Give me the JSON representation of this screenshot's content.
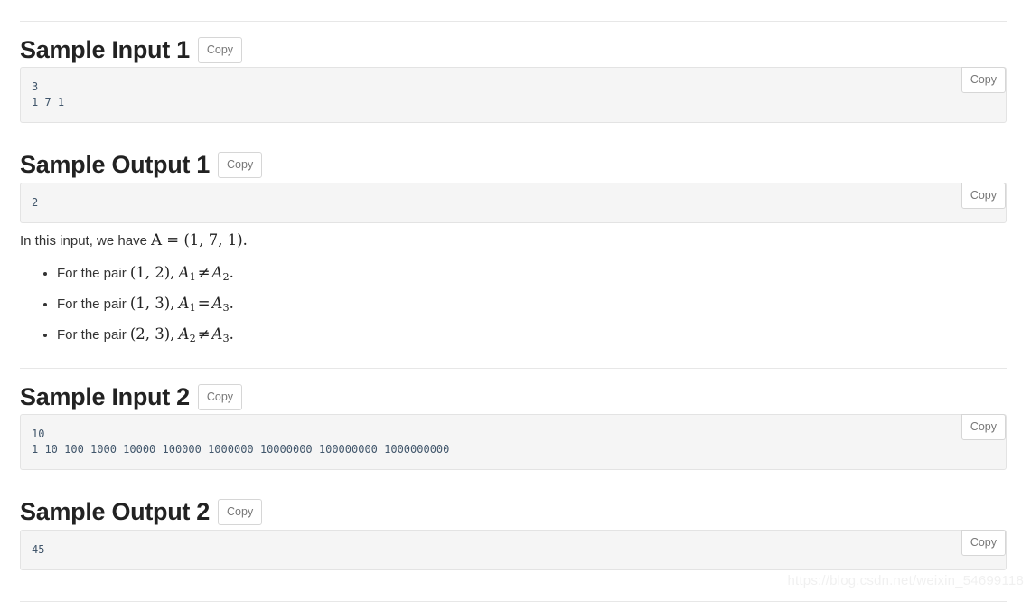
{
  "copy_label": "Copy",
  "sections": [
    {
      "id": "sample-input-1",
      "title": "Sample Input 1",
      "code": "3\n1 7 1"
    },
    {
      "id": "sample-output-1",
      "title": "Sample Output 1",
      "code": "2"
    },
    {
      "id": "sample-input-2",
      "title": "Sample Input 2",
      "code": "10\n1 10 100 1000 10000 100000 1000000 10000000 100000000 1000000000"
    },
    {
      "id": "sample-output-2",
      "title": "Sample Output 2",
      "code": "45"
    }
  ],
  "explanation": {
    "intro_prefix": "In this input, we have ",
    "intro_math": "A = (1, 7, 1).",
    "bullets": [
      {
        "text": "For the pair ",
        "pair": "(1, 2),",
        "relation_left": "A",
        "relation_left_sub": "1",
        "operator": "≠",
        "relation_right": "A",
        "relation_right_sub": "2",
        "suffix": "."
      },
      {
        "text": "For the pair ",
        "pair": "(1, 3),",
        "relation_left": "A",
        "relation_left_sub": "1",
        "operator": "=",
        "relation_right": "A",
        "relation_right_sub": "3",
        "suffix": "."
      },
      {
        "text": "For the pair ",
        "pair": "(2, 3),",
        "relation_left": "A",
        "relation_left_sub": "2",
        "operator": "≠",
        "relation_right": "A",
        "relation_right_sub": "3",
        "suffix": "."
      }
    ]
  },
  "watermark": "https://blog.csdn.net/weixin_54699118"
}
